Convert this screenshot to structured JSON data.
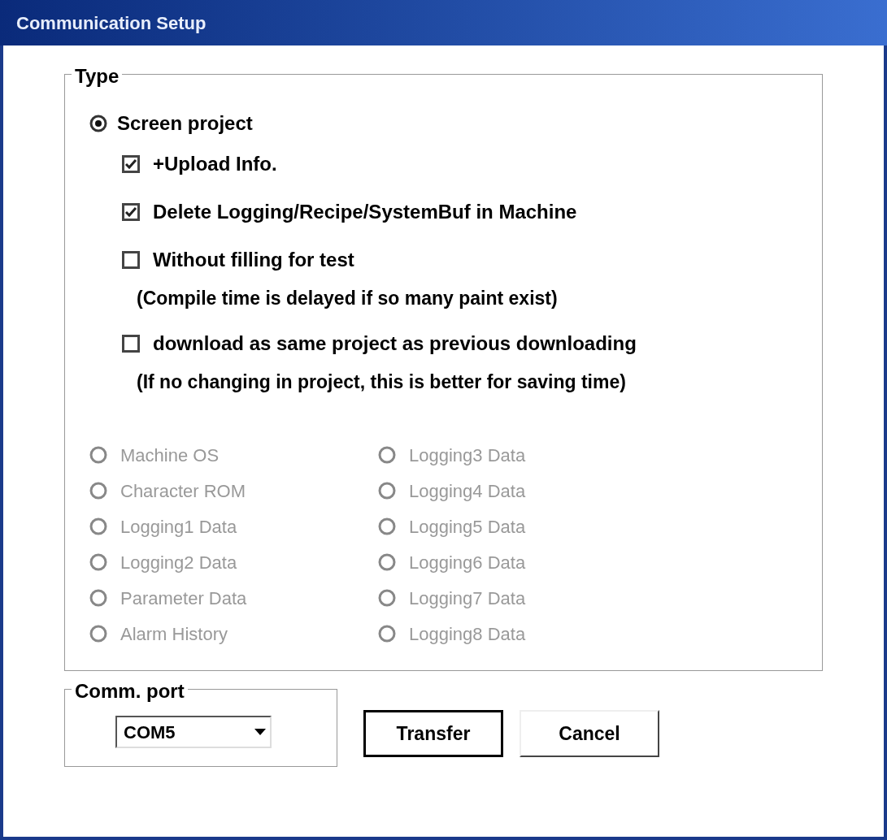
{
  "window": {
    "title": "Communication Setup"
  },
  "type_group": {
    "label": "Type",
    "options": [
      {
        "kind": "radio",
        "label": "Screen project",
        "selected": true,
        "children": [
          {
            "kind": "check",
            "label": "+Upload Info.",
            "checked": true
          },
          {
            "kind": "check",
            "label": "Delete Logging/Recipe/SystemBuf in Machine",
            "checked": true
          },
          {
            "kind": "check",
            "label": "Without filling for test",
            "checked": false
          },
          {
            "kind": "note",
            "label": "(Compile time is delayed if so many paint exist)"
          },
          {
            "kind": "check",
            "label": "download as same project as previous downloading",
            "checked": false
          },
          {
            "kind": "note",
            "label": "(If no changing in project, this is better for saving time)"
          }
        ]
      }
    ],
    "other_types": [
      {
        "label": "Machine OS",
        "selected": false,
        "disabled": true
      },
      {
        "label": "Logging3 Data",
        "selected": false,
        "disabled": true
      },
      {
        "label": "Character ROM",
        "selected": false,
        "disabled": true
      },
      {
        "label": "Logging4 Data",
        "selected": false,
        "disabled": true
      },
      {
        "label": "Logging1 Data",
        "selected": false,
        "disabled": true
      },
      {
        "label": "Logging5 Data",
        "selected": false,
        "disabled": true
      },
      {
        "label": "Logging2 Data",
        "selected": false,
        "disabled": true
      },
      {
        "label": "Logging6 Data",
        "selected": false,
        "disabled": true
      },
      {
        "label": "Parameter Data",
        "selected": false,
        "disabled": true
      },
      {
        "label": "Logging7 Data",
        "selected": false,
        "disabled": true
      },
      {
        "label": "Alarm History",
        "selected": false,
        "disabled": true
      },
      {
        "label": "Logging8 Data",
        "selected": false,
        "disabled": true
      }
    ]
  },
  "comm_port": {
    "label": "Comm. port",
    "value": "COM5"
  },
  "buttons": [
    {
      "label": "Transfer",
      "default": true
    },
    {
      "label": "Cancel",
      "default": false
    }
  ]
}
